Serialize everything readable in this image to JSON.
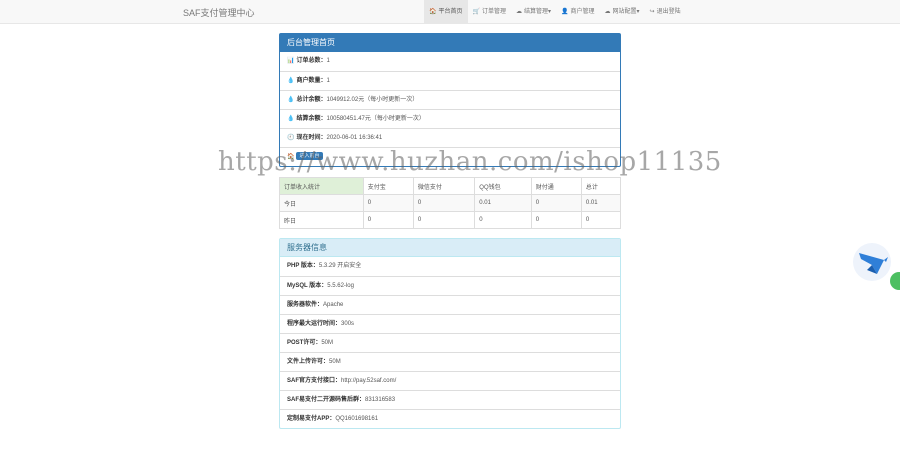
{
  "navbar": {
    "brand": "SAF支付管理中心",
    "items": [
      {
        "icon": "home-icon",
        "glyph": "🏠",
        "label": "平台首页",
        "active": true
      },
      {
        "icon": "cart-icon",
        "glyph": "🛒",
        "label": "订单管理"
      },
      {
        "icon": "cloud-icon",
        "glyph": "☁",
        "label": "结算管理▾"
      },
      {
        "icon": "user-icon",
        "glyph": "👤",
        "label": "商户管理"
      },
      {
        "icon": "cloud-icon",
        "glyph": "☁",
        "label": "网站配置▾"
      },
      {
        "icon": "logout-icon",
        "glyph": "↪",
        "label": "退出登陆"
      }
    ]
  },
  "admin_panel": {
    "title": "后台管理首页",
    "rows": [
      {
        "icon": "chart-icon",
        "glyph": "📊",
        "label": "订单总数：",
        "value": "1"
      },
      {
        "icon": "drop-icon",
        "glyph": "💧",
        "label": "商户数量：",
        "value": "1"
      },
      {
        "icon": "drop-icon",
        "glyph": "💧",
        "label": "总计余额：",
        "value": "1049912.02元（每小时更新一次）"
      },
      {
        "icon": "drop-icon",
        "glyph": "💧",
        "label": "结算余额：",
        "value": "100580451.47元（每小时更新一次）"
      },
      {
        "icon": "clock-icon",
        "glyph": "🕘",
        "label": "现在时间：",
        "value": "2020-06-01 16:36:41"
      }
    ],
    "button_row": {
      "icon": "home-icon",
      "glyph": "🏠",
      "button_label": "进入前台"
    }
  },
  "stats_table": {
    "headers": [
      "订单收入统计",
      "支付宝",
      "微信支付",
      "QQ钱包",
      "财付通",
      "总计"
    ],
    "rows": [
      [
        "今日",
        "0",
        "0",
        "0.01",
        "0",
        "0.01"
      ],
      [
        "昨日",
        "0",
        "0",
        "0",
        "0",
        "0"
      ]
    ]
  },
  "server_panel": {
    "title": "服务器信息",
    "rows": [
      {
        "label": "PHP 版本：",
        "value": "5.3.29 开启安全"
      },
      {
        "label": "MySQL 版本：",
        "value": "5.5.62-log"
      },
      {
        "label": "服务器软件：",
        "value": "Apache"
      },
      {
        "label": "程序最大运行时间：",
        "value": "300s"
      },
      {
        "label": "POST许可：",
        "value": "50M"
      },
      {
        "label": "文件上传许可：",
        "value": "50M"
      },
      {
        "label": "SAF官方支付接口：",
        "value": "http://pay.52saf.com/"
      },
      {
        "label": "SAF易支付二开源码售后群：",
        "value": "831316583"
      },
      {
        "label": "定制易支付APP：",
        "value": "QQ1601698161"
      }
    ]
  },
  "watermark": "https://www.huzhan.com/ishop11135"
}
